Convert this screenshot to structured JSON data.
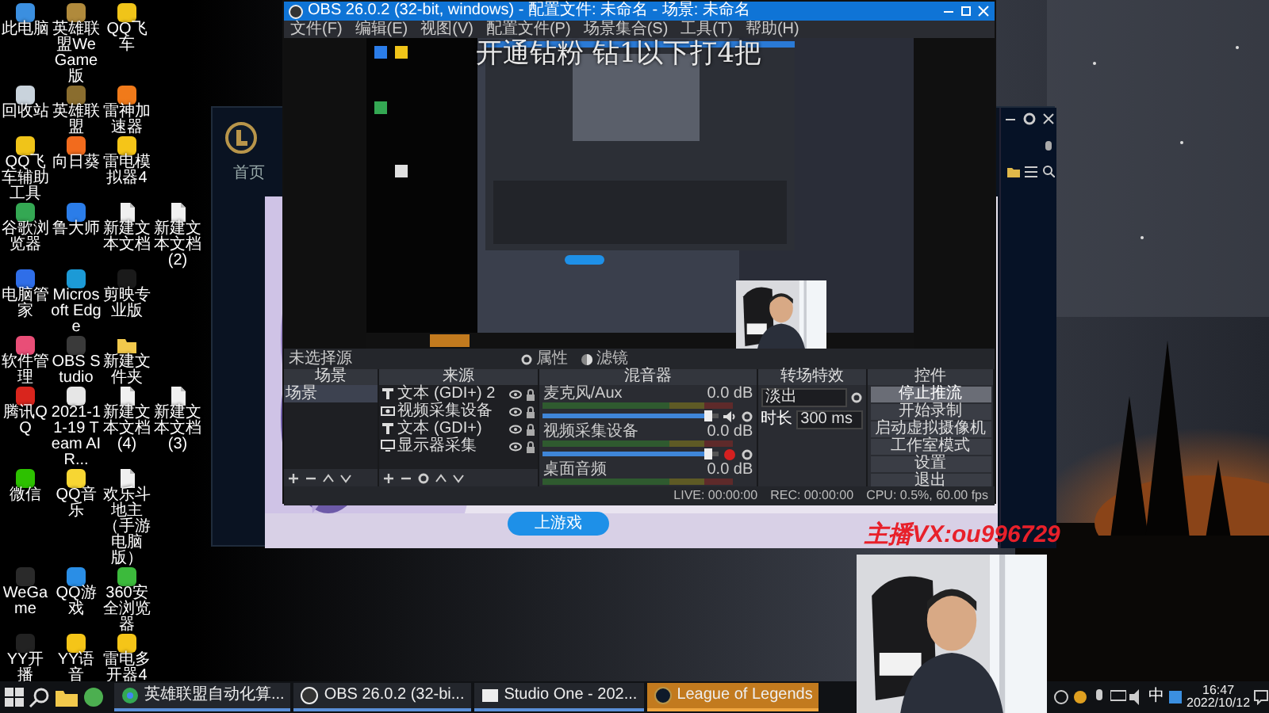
{
  "desktop": {
    "icon_rows": [
      [
        {
          "label": "此电脑",
          "kind": "app",
          "color": "#3b8fe0"
        },
        {
          "label": "英雄联盟WeGame版",
          "kind": "app",
          "color": "#b08a3c"
        },
        {
          "label": "QQ飞车",
          "kind": "app",
          "color": "#f0c419"
        }
      ],
      [
        {
          "label": "回收站",
          "kind": "app",
          "color": "#c9d3dc"
        },
        {
          "label": "英雄联盟",
          "kind": "app",
          "color": "#8a6d2e"
        },
        {
          "label": "雷神加速器",
          "kind": "app",
          "color": "#f07a1a"
        }
      ],
      [
        {
          "label": "QQ飞车辅助工具",
          "kind": "app",
          "color": "#f0c419"
        },
        {
          "label": "向日葵",
          "kind": "app",
          "color": "#f26b1d"
        },
        {
          "label": "雷电模拟器4",
          "kind": "app",
          "color": "#f5c518"
        }
      ],
      [
        {
          "label": "谷歌浏览器",
          "kind": "app",
          "color": "#34a853"
        },
        {
          "label": "鲁大师",
          "kind": "app",
          "color": "#2b7de9"
        },
        {
          "label": "新建文本文档",
          "kind": "file"
        },
        {
          "label": "新建文本文档 (2)",
          "kind": "file"
        }
      ],
      [
        {
          "label": "电脑管家",
          "kind": "app",
          "color": "#2f6ee8"
        },
        {
          "label": "Microsoft Edge",
          "kind": "app",
          "color": "#1c9ad6"
        },
        {
          "label": "剪映专业版",
          "kind": "app",
          "color": "#1a1a1a"
        }
      ],
      [
        {
          "label": "软件管理",
          "kind": "app",
          "color": "#e94e77"
        },
        {
          "label": "OBS Studio",
          "kind": "app",
          "color": "#3a3a3a"
        },
        {
          "label": "新建文件夹",
          "kind": "folder"
        }
      ],
      [
        {
          "label": "腾讯QQ",
          "kind": "app",
          "color": "#d9251d"
        },
        {
          "label": "2021-11-19 Team AIR...",
          "kind": "app",
          "color": "#e6e6e6"
        },
        {
          "label": "新建文本文档 (4)",
          "kind": "file"
        },
        {
          "label": "新建文本文档 (3)",
          "kind": "file"
        }
      ],
      [
        {
          "label": "微信",
          "kind": "app",
          "color": "#2dc100"
        },
        {
          "label": "QQ音乐",
          "kind": "app",
          "color": "#f7d633"
        },
        {
          "label": "欢乐斗地主（手游电脑版）",
          "kind": "file"
        }
      ],
      [
        {
          "label": "WeGame",
          "kind": "app",
          "color": "#2a2a2a"
        },
        {
          "label": "QQ游戏",
          "kind": "app",
          "color": "#2a8ee6"
        },
        {
          "label": "360安全浏览器",
          "kind": "app",
          "color": "#3cba3c"
        }
      ],
      [
        {
          "label": "YY开播",
          "kind": "app",
          "color": "#222222"
        },
        {
          "label": "YY语音",
          "kind": "app",
          "color": "#f5c518"
        },
        {
          "label": "雷电多开器4",
          "kind": "app",
          "color": "#f5c518"
        }
      ]
    ]
  },
  "lol_window": {
    "tab": "首页",
    "button": "上游戏"
  },
  "obs": {
    "title": "OBS 26.0.2 (32-bit, windows) - 配置文件: 未命名 - 场景: 未命名",
    "menu": [
      "文件(F)",
      "编辑(E)",
      "视图(V)",
      "配置文件(P)",
      "场景集合(S)",
      "工具(T)",
      "帮助(H)"
    ],
    "source_bar": {
      "label": "未选择源",
      "buttons": [
        {
          "label": "属性",
          "kind": "properties"
        },
        {
          "label": "滤镜",
          "kind": "filters"
        }
      ]
    },
    "scenes": {
      "title": "场景",
      "items": [
        {
          "label": "场景",
          "selected": true
        }
      ]
    },
    "sources": {
      "title": "来源",
      "items": [
        {
          "label": "文本 (GDI+) 2",
          "kind": "text"
        },
        {
          "label": "视频采集设备",
          "kind": "camera"
        },
        {
          "label": "文本 (GDI+)",
          "kind": "text"
        },
        {
          "label": "显示器采集",
          "kind": "monitor"
        }
      ]
    },
    "mixer": {
      "title": "混音器",
      "channels": [
        {
          "name": "麦克风/Aux",
          "reading": "0.0 dB",
          "level": 0.95,
          "muted": false
        },
        {
          "name": "视频采集设备",
          "reading": "0.0 dB",
          "level": 0.95,
          "muted": true
        },
        {
          "name": "桌面音频",
          "reading": "0.0 dB"
        }
      ]
    },
    "transitions": {
      "title": "转场特效",
      "select": "淡出",
      "duration_label": "时长",
      "duration": "300 ms"
    },
    "controls": {
      "title": "控件",
      "buttons": [
        {
          "label": "停止推流",
          "active": true
        },
        {
          "label": "开始录制",
          "active": false
        },
        {
          "label": "启动虚拟摄像机",
          "active": false
        },
        {
          "label": "工作室模式",
          "active": false
        },
        {
          "label": "设置",
          "active": false
        },
        {
          "label": "退出",
          "active": false
        }
      ]
    },
    "status": [
      "LIVE: 00:00:00",
      "REC: 00:00:00",
      "CPU: 0.5%, 60.00 fps"
    ]
  },
  "stream_overlays": {
    "headline": "开通钻粉 钻1以下打4把",
    "contact": "主播VX:ou996729"
  },
  "taskbar": {
    "items": [
      {
        "label": "英雄联盟自动化算...",
        "kind": "browser",
        "selected": false
      },
      {
        "label": "OBS 26.0.2 (32-bi...",
        "kind": "obs",
        "selected": false
      },
      {
        "label": "Studio One - 202...",
        "kind": "studio",
        "selected": false
      },
      {
        "label": "League of Legends",
        "kind": "lol",
        "selected": true
      }
    ],
    "ime": "中",
    "time": "16:47",
    "date": "2022/10/12"
  }
}
